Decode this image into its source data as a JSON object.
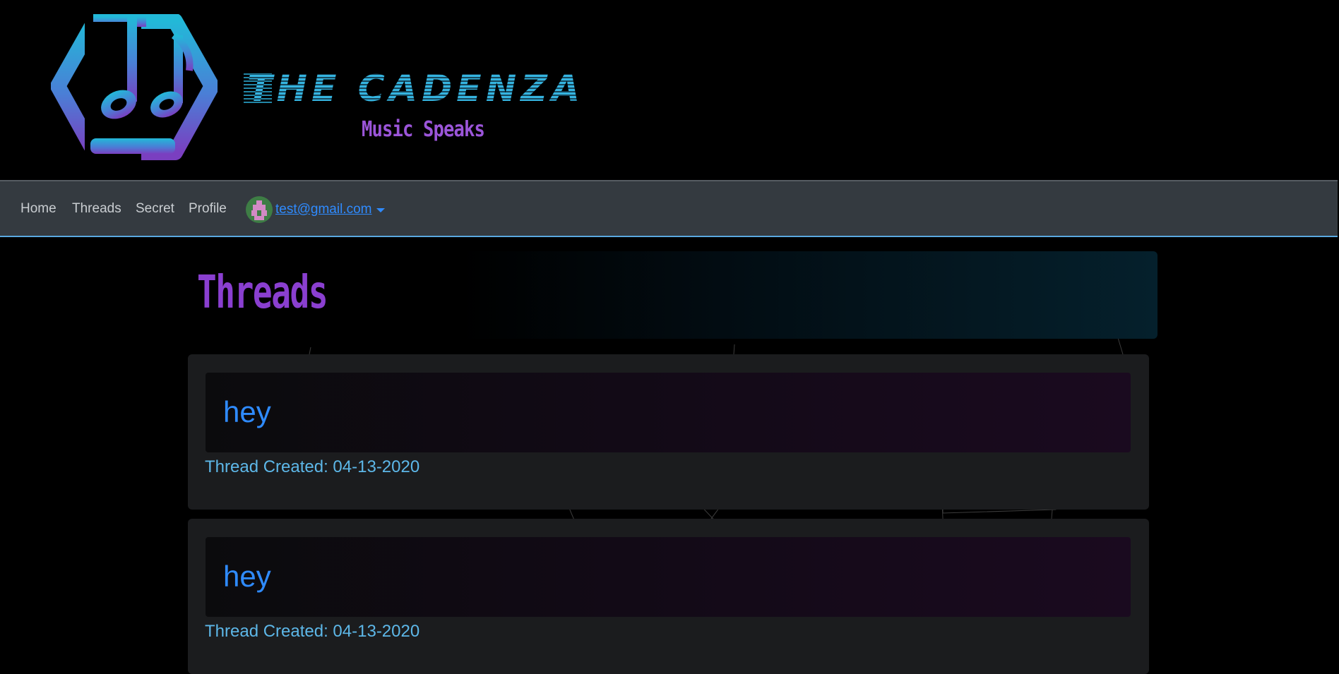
{
  "brand": {
    "title": "The Cadenza",
    "tagline": "Music Speaks",
    "logo_icon": "music-notes-hexagon-icon"
  },
  "nav": {
    "items": [
      {
        "label": "Home"
      },
      {
        "label": "Threads"
      },
      {
        "label": "Secret"
      },
      {
        "label": "Profile"
      }
    ],
    "user": {
      "email": "test@gmail.com",
      "avatar_icon": "pixel-avatar-icon",
      "dropdown_icon": "caret-down-icon"
    }
  },
  "page": {
    "title": "Threads"
  },
  "threads": [
    {
      "title": "hey",
      "created": "Thread Created: 04-13-2020"
    },
    {
      "title": "hey",
      "created": "Thread Created: 04-13-2020"
    }
  ],
  "colors": {
    "background": "#000000",
    "navbar": "#343a40",
    "nav_border": "#5aa8e0",
    "link": "#2f8bff",
    "date": "#5db7e8",
    "title_purple": "#8a3fd0",
    "brand_blue": "#2aa7cf"
  }
}
